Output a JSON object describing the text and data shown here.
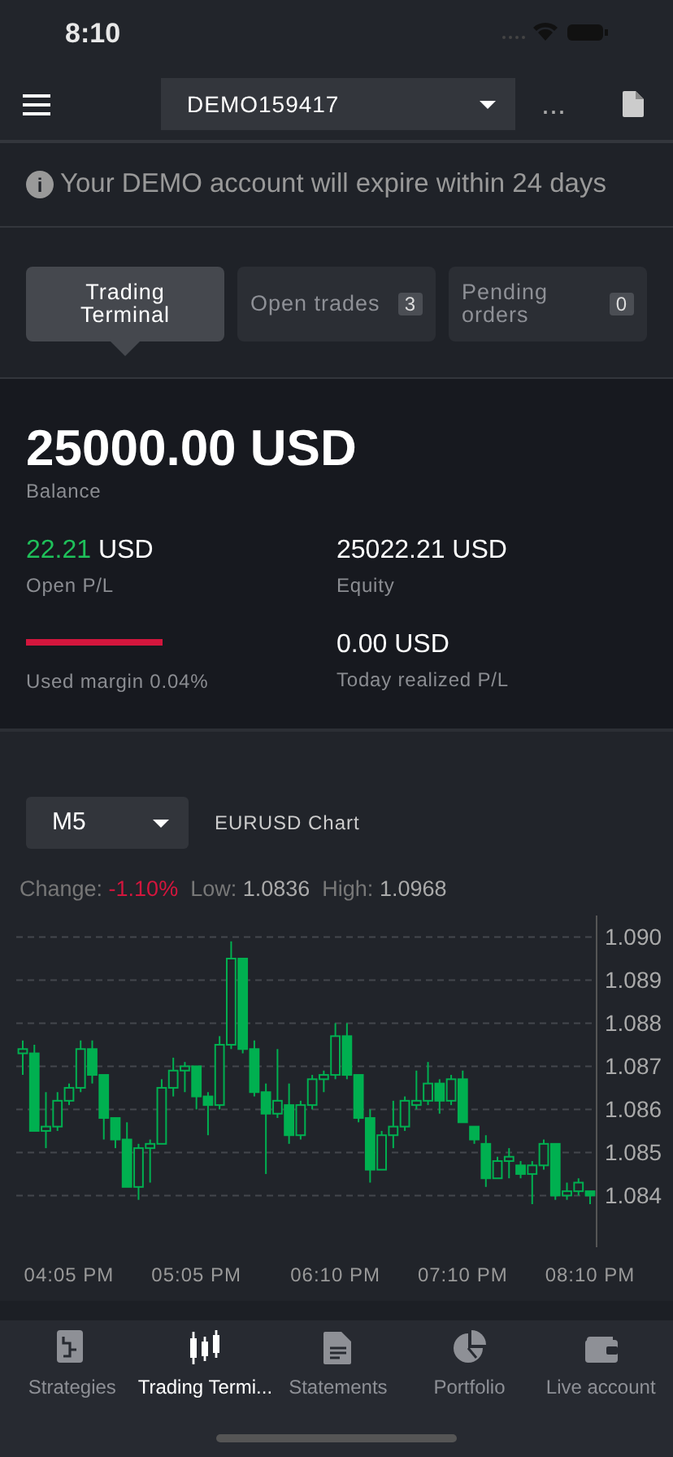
{
  "status_bar": {
    "time": "8:10"
  },
  "header": {
    "account": "DEMO159417",
    "more": "..."
  },
  "notice": {
    "icon": "i",
    "text": "Your DEMO account will expire within 24 days"
  },
  "tabs": [
    {
      "label": "Trading Terminal",
      "selected": true
    },
    {
      "label": "Open trades",
      "count": "3",
      "selected": false
    },
    {
      "label": "Pending orders",
      "count": "0",
      "selected": false
    }
  ],
  "balance": {
    "value": "25000.00 USD",
    "label": "Balance"
  },
  "stats": [
    {
      "kind": "pl",
      "amount": "22.21",
      "currency": "USD",
      "label": "Open P/L"
    },
    {
      "kind": "margin",
      "label": "Used margin 0.04%"
    },
    {
      "kind": "plain",
      "value": "25022.21 USD",
      "label": "Equity"
    },
    {
      "kind": "plain",
      "value": "0.00 USD",
      "label": "Today realized P/L"
    }
  ],
  "chart_panel": {
    "timeframe": "M5",
    "title": "EURUSD Chart",
    "change_label": "Change:",
    "change": "-1.10%",
    "low_label": "Low:",
    "low": "1.0836",
    "high_label": "High:",
    "high": "1.0968",
    "chart_data": {
      "type": "candlestick",
      "grid": true,
      "ylim": [
        1.0828,
        1.0905
      ],
      "yticks": [
        {
          "value": 1.09,
          "label": "1.090"
        },
        {
          "value": 1.089,
          "label": "1.089"
        },
        {
          "value": 1.088,
          "label": "1.088"
        },
        {
          "value": 1.087,
          "label": "1.087"
        },
        {
          "value": 1.086,
          "label": "1.086"
        },
        {
          "value": 1.085,
          "label": "1.085"
        },
        {
          "value": 1.084,
          "label": "1.084"
        }
      ],
      "categories": [
        null,
        null,
        null,
        null,
        "04:05 PM",
        null,
        null,
        null,
        null,
        null,
        null,
        null,
        null,
        null,
        null,
        "05:05 PM",
        null,
        null,
        null,
        null,
        null,
        null,
        null,
        null,
        null,
        null,
        null,
        "06:10 PM",
        null,
        null,
        null,
        null,
        null,
        null,
        null,
        null,
        null,
        null,
        "07:10 PM",
        null,
        null,
        null,
        null,
        null,
        null,
        null,
        null,
        null,
        null,
        "08:10 PM"
      ],
      "ohlc": [
        [
          1.0873,
          1.0876,
          1.0868,
          1.0874
        ],
        [
          1.0873,
          1.0875,
          1.0855,
          1.0855
        ],
        [
          1.0855,
          1.0864,
          1.0851,
          1.0856
        ],
        [
          1.0856,
          1.0864,
          1.0855,
          1.0862
        ],
        [
          1.0862,
          1.0866,
          1.0861,
          1.0865
        ],
        [
          1.0865,
          1.0876,
          1.0864,
          1.0874
        ],
        [
          1.0874,
          1.0876,
          1.0866,
          1.0868
        ],
        [
          1.0868,
          1.0868,
          1.0853,
          1.0858
        ],
        [
          1.0858,
          1.0858,
          1.0851,
          1.0853
        ],
        [
          1.0853,
          1.0857,
          1.0842,
          1.0842
        ],
        [
          1.0842,
          1.0852,
          1.0839,
          1.0851
        ],
        [
          1.0851,
          1.0853,
          1.0843,
          1.0852
        ],
        [
          1.0852,
          1.0867,
          1.0852,
          1.0865
        ],
        [
          1.0865,
          1.0872,
          1.0863,
          1.0869
        ],
        [
          1.0869,
          1.0871,
          1.0864,
          1.087
        ],
        [
          1.087,
          1.087,
          1.086,
          1.0863
        ],
        [
          1.0863,
          1.0864,
          1.0854,
          1.0861
        ],
        [
          1.0861,
          1.0877,
          1.086,
          1.0875
        ],
        [
          1.0875,
          1.0899,
          1.0874,
          1.0895
        ],
        [
          1.0895,
          1.0895,
          1.0873,
          1.0874
        ],
        [
          1.0874,
          1.0876,
          1.0863,
          1.0864
        ],
        [
          1.0864,
          1.0866,
          1.0845,
          1.0859
        ],
        [
          1.0859,
          1.0874,
          1.0858,
          1.0862
        ],
        [
          1.0861,
          1.0866,
          1.0852,
          1.0854
        ],
        [
          1.0854,
          1.0862,
          1.0853,
          1.0861
        ],
        [
          1.0861,
          1.0868,
          1.086,
          1.0867
        ],
        [
          1.0867,
          1.0869,
          1.0864,
          1.0868
        ],
        [
          1.0868,
          1.088,
          1.0867,
          1.0877
        ],
        [
          1.0877,
          1.088,
          1.0867,
          1.0868
        ],
        [
          1.0868,
          1.0868,
          1.0857,
          1.0858
        ],
        [
          1.0858,
          1.086,
          1.0843,
          1.0846
        ],
        [
          1.0846,
          1.0855,
          1.0846,
          1.0854
        ],
        [
          1.0854,
          1.0862,
          1.0851,
          1.0856
        ],
        [
          1.0856,
          1.0863,
          1.0855,
          1.0862
        ],
        [
          1.0861,
          1.0869,
          1.086,
          1.0862
        ],
        [
          1.0862,
          1.0871,
          1.0861,
          1.0866
        ],
        [
          1.0866,
          1.0867,
          1.0859,
          1.0862
        ],
        [
          1.0862,
          1.0868,
          1.0861,
          1.0867
        ],
        [
          1.0867,
          1.0869,
          1.0857,
          1.0857
        ],
        [
          1.0856,
          1.0856,
          1.0852,
          1.0853
        ],
        [
          1.0852,
          1.0854,
          1.0842,
          1.0844
        ],
        [
          1.0844,
          1.0849,
          1.0844,
          1.0848
        ],
        [
          1.0848,
          1.0851,
          1.0844,
          1.0849
        ],
        [
          1.0847,
          1.0848,
          1.0844,
          1.0845
        ],
        [
          1.0845,
          1.0848,
          1.0838,
          1.0847
        ],
        [
          1.0847,
          1.0853,
          1.0846,
          1.0852
        ],
        [
          1.0852,
          1.0852,
          1.0839,
          1.084
        ],
        [
          1.084,
          1.0843,
          1.0839,
          1.0841
        ],
        [
          1.0841,
          1.0844,
          1.084,
          1.0843
        ],
        [
          1.0841,
          1.0841,
          1.0838,
          1.084
        ]
      ]
    }
  },
  "bottom_nav": [
    {
      "label": "Strategies",
      "selected": false
    },
    {
      "label": "Trading Termi...",
      "selected": true
    },
    {
      "label": "Statements",
      "selected": false
    },
    {
      "label": "Portfolio",
      "selected": false
    },
    {
      "label": "Live account",
      "selected": false
    }
  ]
}
